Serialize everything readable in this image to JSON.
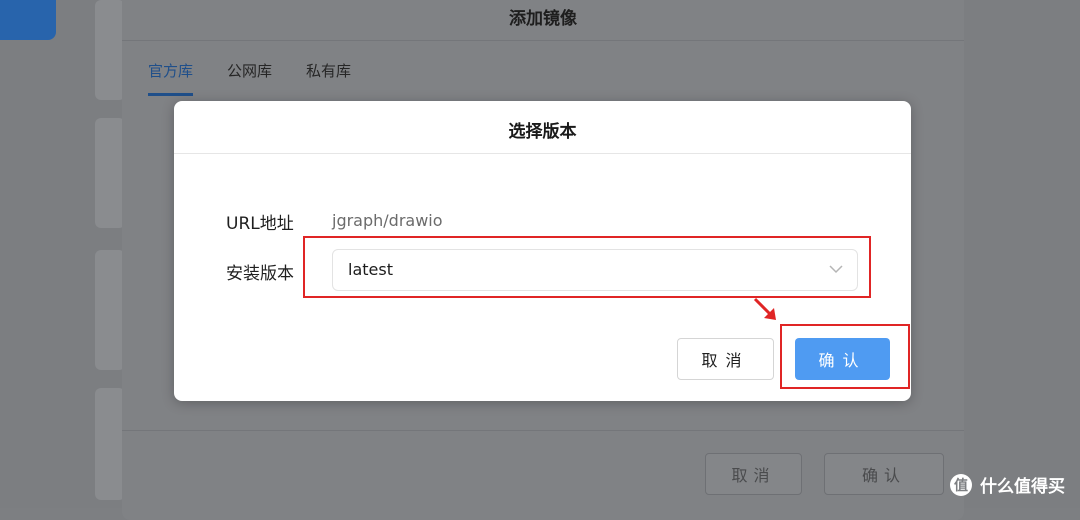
{
  "outer_dialog": {
    "title": "添加镜像",
    "tabs": [
      {
        "label": "官方库",
        "active": true
      },
      {
        "label": "公网库",
        "active": false
      },
      {
        "label": "私有库",
        "active": false
      }
    ],
    "cancel_label": "取消",
    "confirm_label": "确认"
  },
  "inner_dialog": {
    "title": "选择版本",
    "url_label": "URL地址",
    "url_value": "jgraph/drawio",
    "version_label": "安装版本",
    "version_value": "latest",
    "cancel_label": "取消",
    "confirm_label": "确认"
  },
  "watermark": {
    "logo_char": "值",
    "text": "什么值得买"
  },
  "colors": {
    "primary": "#4f9bf2",
    "annotation": "#e02525"
  }
}
